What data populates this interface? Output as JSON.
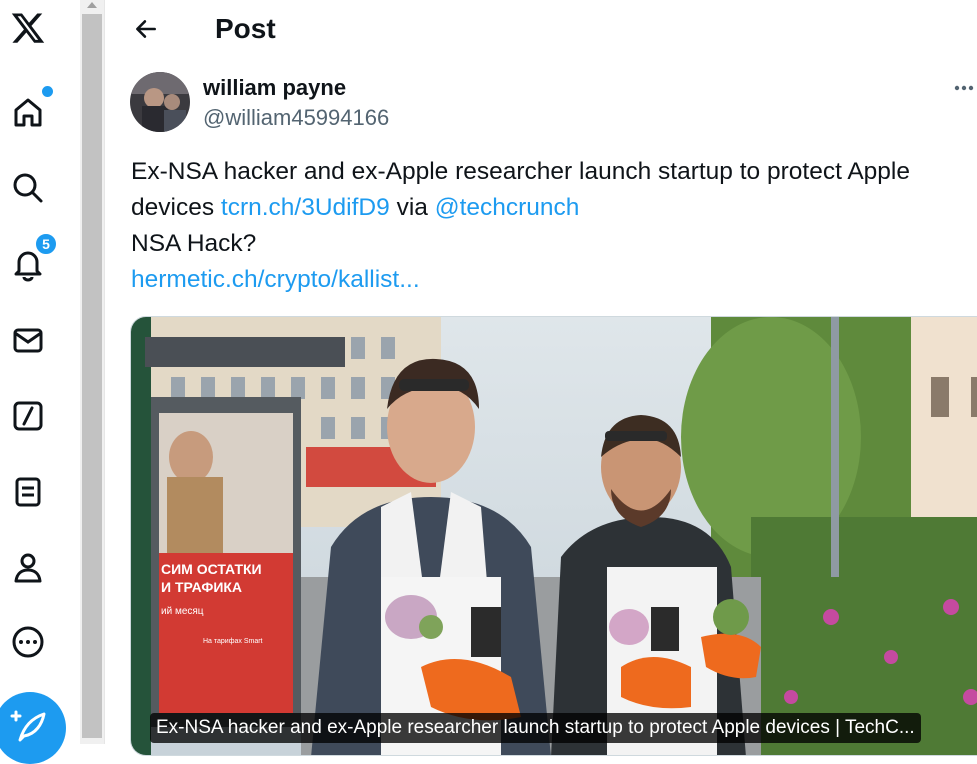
{
  "header": {
    "title": "Post"
  },
  "nav": {
    "notifications_badge": "5"
  },
  "post": {
    "author_name": "william payne",
    "author_handle": "@william45994166",
    "text_line1": "Ex-NSA hacker and ex-Apple researcher launch startup to protect Apple",
    "text_line2_prefix": "devices",
    "link1": "tcrn.ch/3UdifD9",
    "text_via": "via",
    "mention": "@techcrunch",
    "text_line3": "NSA Hack?",
    "link2": "hermetic.ch/crypto/kallist...",
    "card_caption": "Ex-NSA hacker and ex-Apple researcher launch startup to protect Apple devices | TechC...",
    "image_sign_line1": "СИМ ОСТАТКИ",
    "image_sign_line2": "И ТРАФИКА",
    "image_sign_line3": "ий месяц",
    "image_sign_line4": "На тарифах Smart"
  },
  "colors": {
    "accent": "#1d9bf0",
    "text": "#0f1419",
    "secondary": "#536471"
  }
}
